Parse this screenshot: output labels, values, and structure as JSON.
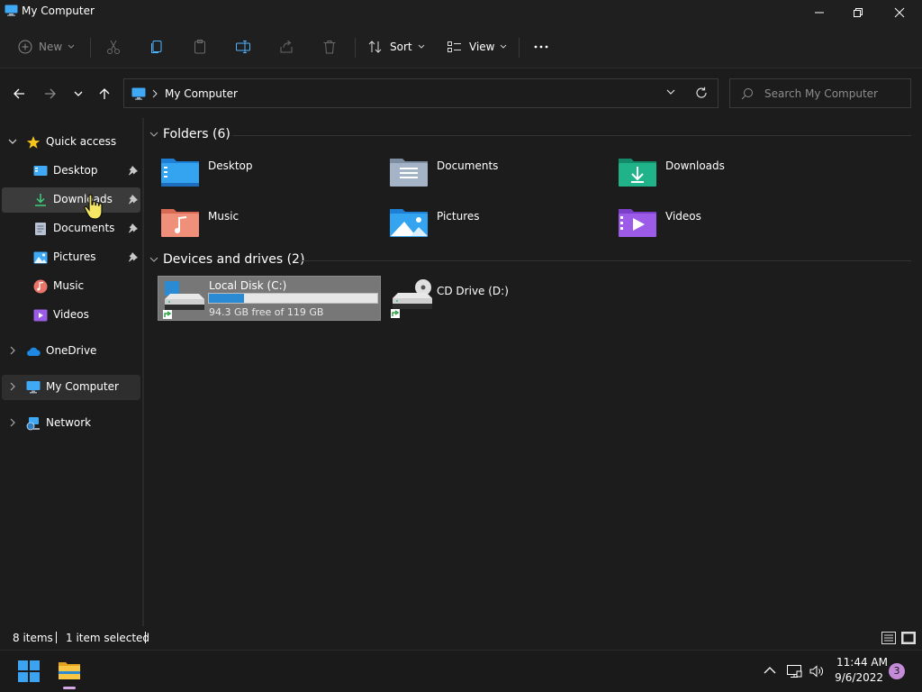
{
  "window": {
    "title": "My Computer"
  },
  "toolbar": {
    "new_label": "New",
    "sort_label": "Sort",
    "view_label": "View"
  },
  "address": {
    "crumb": "My Computer"
  },
  "search": {
    "placeholder": "Search My Computer"
  },
  "sidebar": {
    "items": [
      {
        "label": "Quick access",
        "icon": "star-icon"
      },
      {
        "label": "Desktop",
        "icon": "desktop-icon",
        "pinned": true
      },
      {
        "label": "Downloads",
        "icon": "download-icon",
        "pinned": true
      },
      {
        "label": "Documents",
        "icon": "document-icon",
        "pinned": true
      },
      {
        "label": "Pictures",
        "icon": "pictures-icon",
        "pinned": true
      },
      {
        "label": "Music",
        "icon": "music-icon"
      },
      {
        "label": "Videos",
        "icon": "videos-icon"
      },
      {
        "label": "OneDrive",
        "icon": "cloud-icon"
      },
      {
        "label": "My Computer",
        "icon": "computer-icon"
      },
      {
        "label": "Network",
        "icon": "network-icon"
      }
    ]
  },
  "sections": {
    "folders_title": "Folders (6)",
    "drives_title": "Devices and drives (2)"
  },
  "folders": [
    {
      "label": "Desktop",
      "icon": "folder-desktop-icon"
    },
    {
      "label": "Documents",
      "icon": "folder-documents-icon"
    },
    {
      "label": "Downloads",
      "icon": "folder-downloads-icon"
    },
    {
      "label": "Music",
      "icon": "folder-music-icon"
    },
    {
      "label": "Pictures",
      "icon": "folder-pictures-icon"
    },
    {
      "label": "Videos",
      "icon": "folder-videos-icon"
    }
  ],
  "drives": [
    {
      "label": "Local Disk (C:)",
      "free_text": "94.3 GB free of 119 GB",
      "used_fraction": 0.21,
      "icon": "hard-drive-icon"
    },
    {
      "label": "CD Drive (D:)",
      "icon": "cd-drive-icon"
    }
  ],
  "status": {
    "items": "8 items",
    "selected": "1 item selected"
  },
  "taskbar": {
    "time": "11:44 AM",
    "date": "9/6/2022",
    "notifications": "3"
  },
  "colors": {
    "accent": "#2a8ad4",
    "folder_blue": "#2196f3",
    "selection_bg": "#777777"
  }
}
